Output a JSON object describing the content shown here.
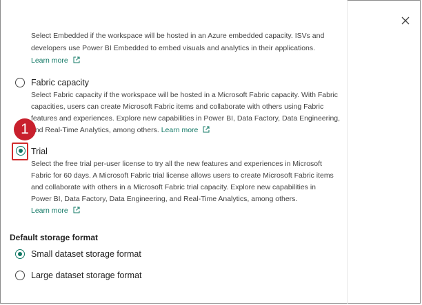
{
  "dialog": {
    "close_label": "Close"
  },
  "options": {
    "embedded": {
      "desc_line1": "Select Embedded if the workspace will be hosted in an Azure embedded capacity. ISVs and",
      "desc_line2": "developers use Power BI Embedded to embed visuals and analytics in their applications.",
      "learn_more": "Learn more"
    },
    "fabric": {
      "label": "Fabric capacity",
      "desc_line1": "Select Fabric capacity if the workspace will be hosted in a Microsoft Fabric capacity. With Fabric",
      "desc_line2": "capacities, users can create Microsoft Fabric items and collaborate with others using Fabric",
      "desc_line3": "features and experiences. Explore new capabilities in Power BI, Data Factory, Data Engineering,",
      "desc_line4": "and Real-Time Analytics, among others.",
      "learn_more": "Learn more"
    },
    "trial": {
      "label": "Trial",
      "desc_line1": "Select the free trial per-user license to try all the new features and experiences in Microsoft",
      "desc_line2": "Fabric for 60 days. A Microsoft Fabric trial license allows users to create Microsoft Fabric items",
      "desc_line3": "and collaborate with others in a Microsoft Fabric trial capacity. Explore new capabilities in",
      "desc_line4": "Power BI, Data Factory, Data Engineering, and Real-Time Analytics, among others.",
      "learn_more": "Learn more",
      "selected": true
    }
  },
  "storage": {
    "title": "Default storage format",
    "small": "Small dataset storage format",
    "large": "Large dataset storage format",
    "selected": "small"
  },
  "annotation": {
    "step": "1",
    "color": "#c8202d"
  },
  "colors": {
    "accent": "#117865"
  }
}
